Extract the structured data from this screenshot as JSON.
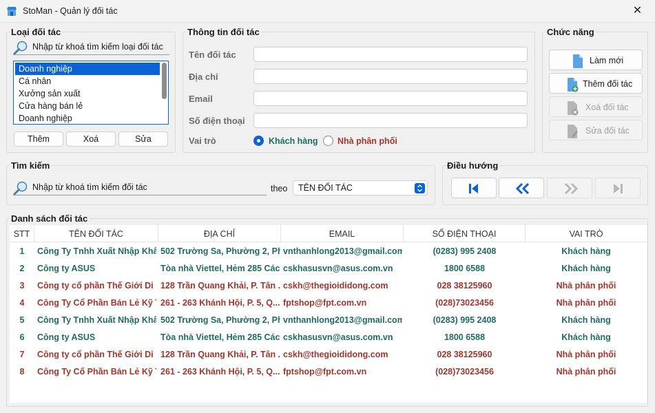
{
  "window": {
    "title": "StoMan - Quản lý đối tác",
    "close_label": "✕"
  },
  "partner_types": {
    "title": "Loại đối tác",
    "search_placeholder": "Nhập từ khoá tìm kiếm loại đối tác",
    "items": [
      "Doanh nghiệp",
      "Cá nhân",
      "Xưởng sản xuất",
      "Cửa hàng bán lẻ",
      "Doanh nghiệp"
    ],
    "selected_index": 0,
    "add_label": "Thêm",
    "delete_label": "Xoá",
    "edit_label": "Sửa"
  },
  "partner_info": {
    "title": "Thông tin đối tác",
    "name_label": "Tên đối tác",
    "address_label": "Địa chỉ",
    "email_label": "Email",
    "phone_label": "Số điện thoại",
    "role_label": "Vai trò",
    "role_options": [
      "Khách hàng",
      "Nhà phân phối"
    ],
    "role_selected": "Khách hàng"
  },
  "functions": {
    "title": "Chức năng",
    "refresh_label": "Làm mới",
    "add_partner_label": "Thêm đối tác",
    "delete_partner_label": "Xoá đối tác",
    "edit_partner_label": "Sửa đối tác"
  },
  "search": {
    "title": "Tìm kiếm",
    "placeholder": "Nhập từ khoá tìm kiếm đối tác",
    "by_label": "theo",
    "by_value": "TÊN ĐỐI TÁC"
  },
  "navigation": {
    "title": "Điều hướng"
  },
  "partner_list": {
    "title": "Danh sách đối tác",
    "columns": [
      "STT",
      "TÊN ĐỐI TÁC",
      "ĐỊA CHỈ",
      "EMAIL",
      "SỐ ĐIỆN THOẠI",
      "VAI TRÒ"
    ],
    "rows": [
      {
        "stt": "1",
        "name": "Công Ty Tnhh Xuất Nhập Khẩ...",
        "address": "502 Trường Sa, Phường 2, Ph...",
        "email": "vnthanhlong2013@gmail.com",
        "phone": "(0283) 995 2408",
        "role": "Khách hàng"
      },
      {
        "stt": "2",
        "name": "Công ty ASUS",
        "address": "Tòa nhà Viettel, Hẻm 285 Các...",
        "email": "cskhasusvn@asus.com.vn",
        "phone": "1800 6588",
        "role": "Khách hàng"
      },
      {
        "stt": "3",
        "name": "Công ty cổ phần Thế Giới Di ...",
        "address": "128 Trần Quang Khải, P. Tân ...",
        "email": "cskh@thegioididong.com",
        "phone": "028 38125960",
        "role": "Nhà phân phối"
      },
      {
        "stt": "4",
        "name": "Công Ty Cổ Phần Bán Lẻ Kỹ T...",
        "address": "261 - 263 Khánh Hội, P. 5, Q....",
        "email": "fptshop@fpt.com.vn",
        "phone": "(028)73023456",
        "role": "Nhà phân phối"
      },
      {
        "stt": "5",
        "name": "Công Ty Tnhh Xuất Nhập Khẩ...",
        "address": "502 Trường Sa, Phường 2, Ph...",
        "email": "vnthanhlong2013@gmail.com",
        "phone": "(0283) 995 2408",
        "role": "Khách hàng"
      },
      {
        "stt": "6",
        "name": "Công ty ASUS",
        "address": "Tòa nhà Viettel, Hẻm 285 Các...",
        "email": "cskhasusvn@asus.com.vn",
        "phone": "1800 6588",
        "role": "Khách hàng"
      },
      {
        "stt": "7",
        "name": "Công ty cổ phần Thế Giới Di ...",
        "address": "128 Trần Quang Khải, P. Tân ...",
        "email": "cskh@thegioididong.com",
        "phone": "028 38125960",
        "role": "Nhà phân phối"
      },
      {
        "stt": "8",
        "name": "Công Ty Cổ Phần Bán Lẻ Kỹ T...",
        "address": "261 - 263 Khánh Hội, P. 5, Q....",
        "email": "fptshop@fpt.com.vn",
        "phone": "(028)73023456",
        "role": "Nhà phân phối"
      }
    ]
  },
  "colors": {
    "accent": "#0a64d3",
    "customer_row": "#1f6b5e",
    "distributor_row": "#a5352a"
  }
}
